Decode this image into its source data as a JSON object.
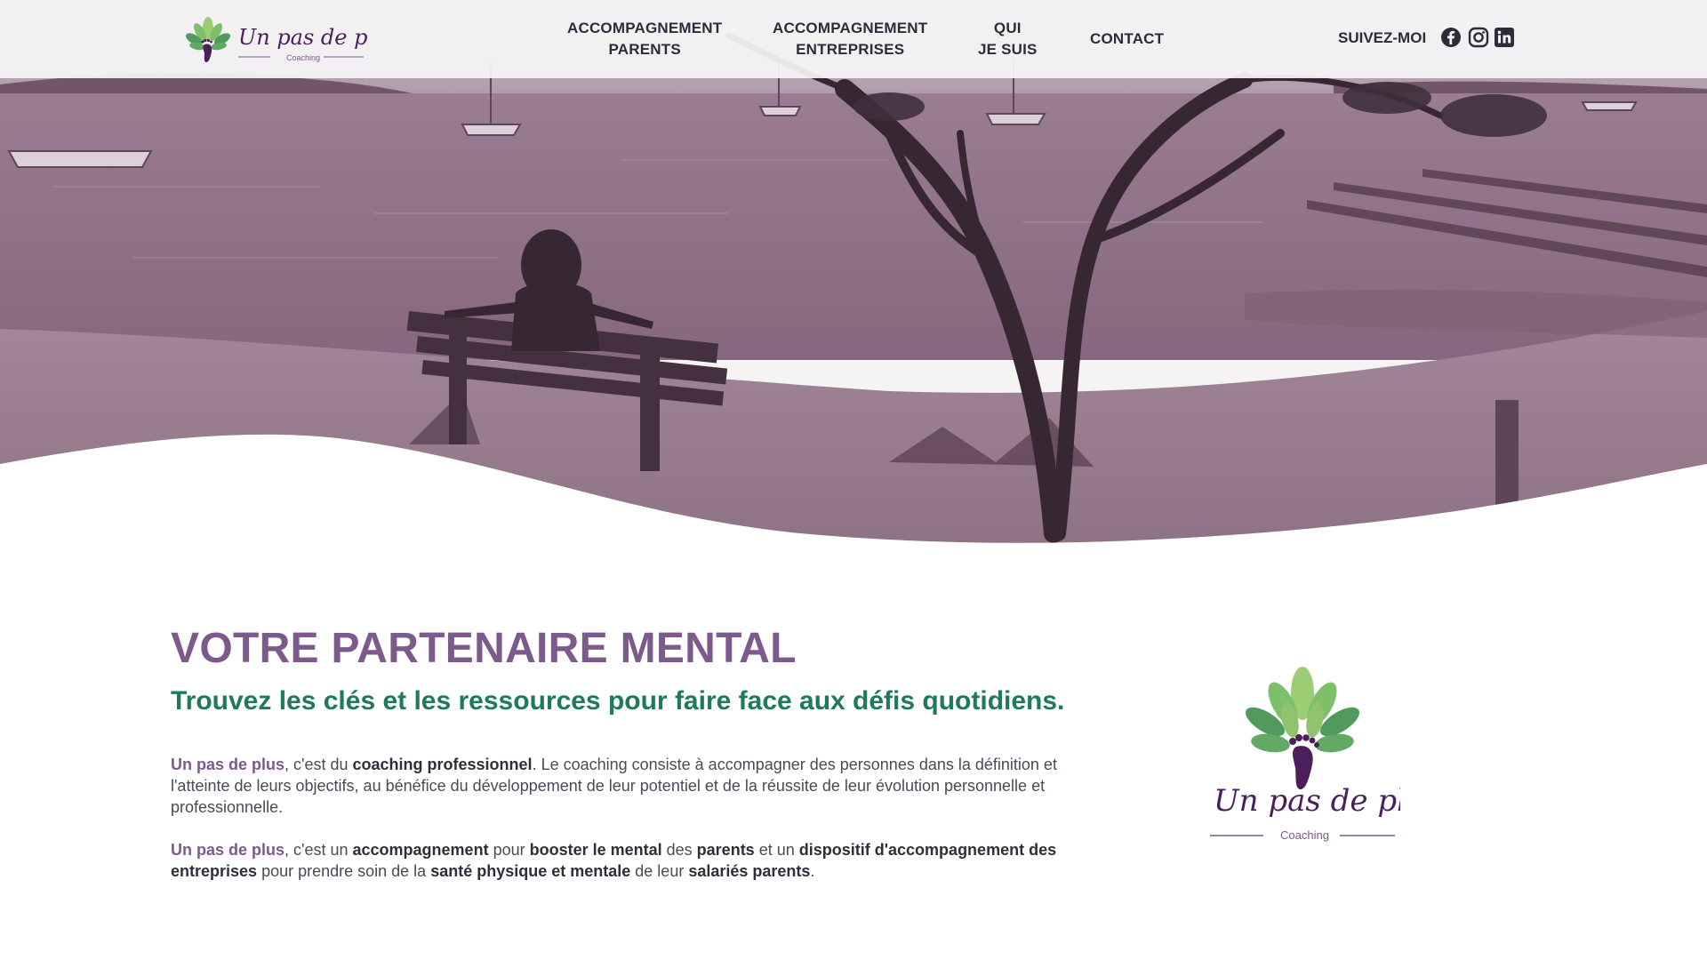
{
  "brand": {
    "logo_script": "Un pas de plus",
    "logo_tagline": "Coaching"
  },
  "nav": {
    "items": [
      {
        "line1": "ACCOMPAGNEMENT",
        "line2": "PARENTS"
      },
      {
        "line1": "ACCOMPAGNEMENT",
        "line2": "ENTREPRISES"
      },
      {
        "line1": "QUI",
        "line2": "JE SUIS"
      },
      {
        "line1": "CONTACT",
        "line2": ""
      }
    ],
    "follow_label": "SUIVEZ-MOI",
    "social": [
      "facebook-icon",
      "instagram-icon",
      "linkedin-icon"
    ]
  },
  "hero": {
    "tint": "#8c6a84"
  },
  "main": {
    "title": "VOTRE PARTENAIRE MENTAL",
    "subtitle": "Trouvez les clés et les ressources pour faire face aux défis quotidiens.",
    "p1": {
      "brand": "Un pas de plus",
      "t1": ", c'est du ",
      "b1": "coaching professionnel",
      "t2": ". Le coaching consiste à accompagner des personnes dans la définition et l'atteinte de leurs objectifs, au bénéfice du développement de leur potentiel et de la réussite de leur évolution personnelle et professionnelle."
    },
    "p2": {
      "brand": "Un pas de plus",
      "t1": ", c'est un ",
      "b1": "accompagnement",
      "t2": " pour ",
      "b2": "booster le mental",
      "t3": " des ",
      "b3": "parents",
      "t4": " et un ",
      "b4": "dispositif d'accompagnement des entreprises",
      "t5": " pour prendre soin de la ",
      "b5": "santé physique et mentale",
      "t6": " de leur ",
      "b6": "salariés parents",
      "t7": "."
    }
  },
  "colors": {
    "purple": "#7d5a8c",
    "green": "#1f7a58",
    "leaf_light": "#9ccc74",
    "leaf_dark": "#4f9a5c",
    "foot": "#4a1f5c"
  }
}
